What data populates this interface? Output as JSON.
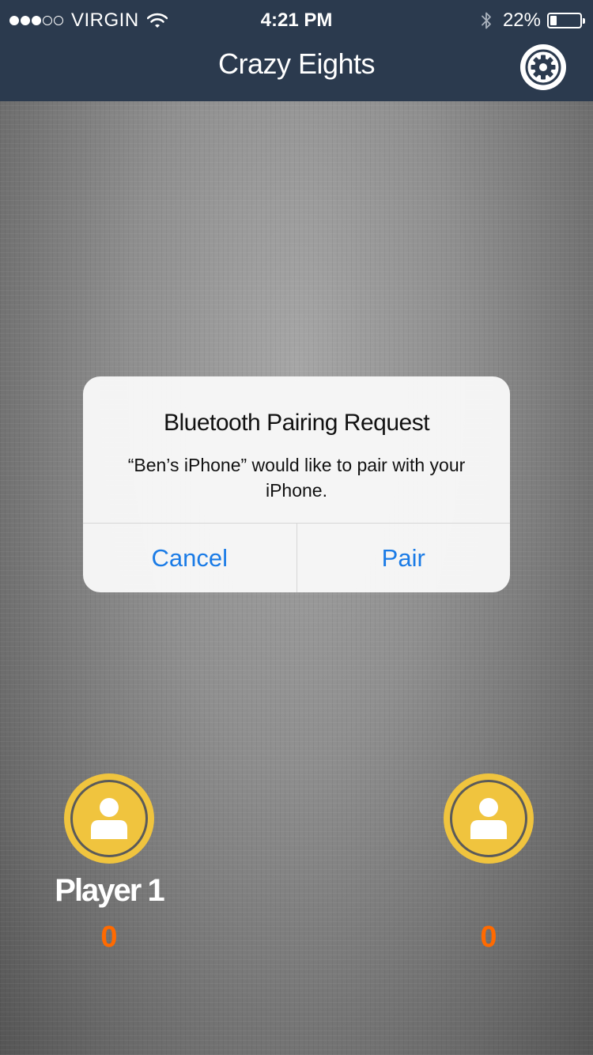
{
  "status_bar": {
    "carrier": "VIRGIN",
    "signal_strength": 3,
    "signal_max": 5,
    "time": "4:21 PM",
    "battery_percent_label": "22%",
    "battery_level": 0.22
  },
  "header": {
    "title": "Crazy Eights",
    "settings_icon": "gear-icon"
  },
  "alert": {
    "title": "Bluetooth Pairing Request",
    "message": "“Ben’s iPhone” would like to pair with your iPhone.",
    "cancel_label": "Cancel",
    "pair_label": "Pair"
  },
  "players": {
    "left": {
      "name": "Player 1",
      "score": "0",
      "avatar_icon": "user-icon"
    },
    "right": {
      "name": "",
      "score": "0",
      "avatar_icon": "user-icon"
    }
  },
  "colors": {
    "header_bg": "#2b3a4e",
    "avatar": "#f0c43e",
    "score": "#ff6a00",
    "alert_button": "#1a7be6"
  }
}
